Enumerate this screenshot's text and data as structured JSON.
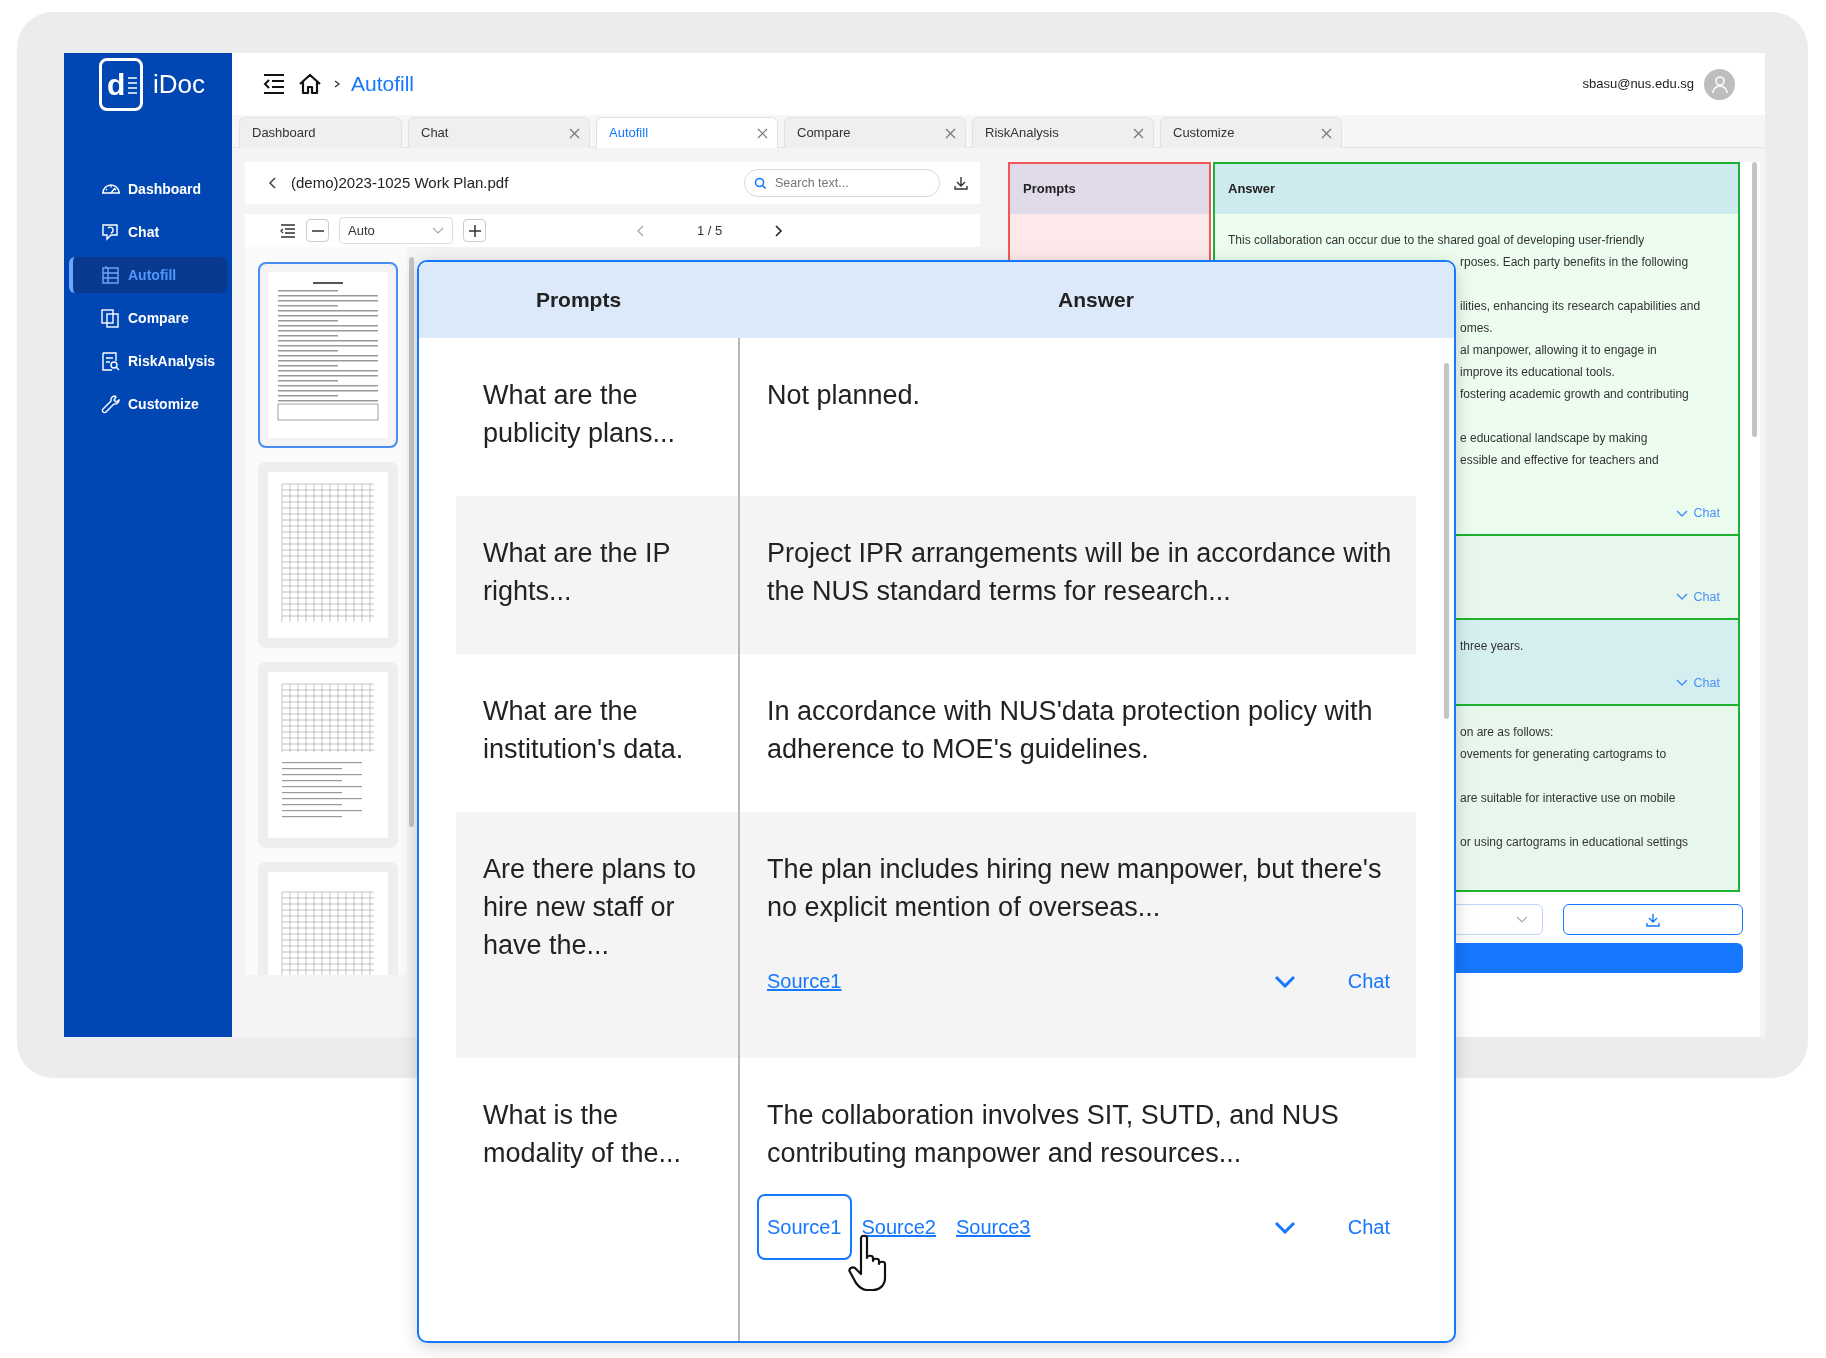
{
  "app": {
    "logo_mark": "d",
    "name": "iDoc"
  },
  "sidebar": {
    "items": [
      {
        "label": "Dashboard",
        "selected": false
      },
      {
        "label": "Chat",
        "selected": false
      },
      {
        "label": "Autofill",
        "selected": true
      },
      {
        "label": "Compare",
        "selected": false
      },
      {
        "label": "RiskAnalysis",
        "selected": false
      },
      {
        "label": "Customize",
        "selected": false
      }
    ]
  },
  "header": {
    "breadcrumb": "Autofill",
    "user_email": "sbasu@nus.edu.sg"
  },
  "tabs": [
    {
      "label": "Dashboard",
      "selected": false,
      "closable": false
    },
    {
      "label": "Chat",
      "selected": false,
      "closable": true
    },
    {
      "label": "Autofill",
      "selected": true,
      "closable": true
    },
    {
      "label": "Compare",
      "selected": false,
      "closable": true
    },
    {
      "label": "RiskAnalysis",
      "selected": false,
      "closable": true
    },
    {
      "label": "Customize",
      "selected": false,
      "closable": true
    }
  ],
  "pdf_viewer": {
    "file_name": "(demo)2023-1025 Work Plan.pdf",
    "search": {
      "placeholder": "Search text..."
    },
    "zoom": "Auto",
    "page_indicator": "1 / 5",
    "thumbnails": [
      {
        "selected": true
      },
      {
        "selected": false
      },
      {
        "selected": false
      },
      {
        "selected": false
      }
    ]
  },
  "results_panel": {
    "columns": [
      "Prompts",
      "Answer"
    ],
    "rows": [
      {
        "selected": false,
        "intro": "This collaboration can occur due to the shared goal of developing user-friendly",
        "paragraphs": [
          [
            "rposes. Each party benefits in the following"
          ],
          [
            "ilities, enhancing its research capabilities and",
            "omes.",
            "al manpower, allowing it to engage in",
            "improve its educational tools.",
            "fostering academic growth and contributing"
          ],
          [
            "e educational landscape by making",
            "essible and effective for teachers and"
          ]
        ],
        "chat": "Chat"
      },
      {
        "selected": false,
        "chat": "Chat"
      },
      {
        "selected": true,
        "paragraphs": [
          [
            "three years."
          ]
        ],
        "chat": "Chat"
      },
      {
        "selected": false,
        "paragraphs": [
          [
            "on are as follows:",
            "ovements for generating cartograms to"
          ],
          [
            "are suitable for interactive use on mobile"
          ],
          [
            "or using cartograms in educational settings"
          ]
        ]
      }
    ]
  },
  "popup": {
    "columns": [
      "Prompts",
      "Answer"
    ],
    "rows": [
      {
        "prompt": "What are the publicity plans...",
        "answer": "Not planned."
      },
      {
        "prompt": "What are the IP rights...",
        "answer": "Project IPR arrangements will be in accordance with the NUS standard terms for research..."
      },
      {
        "prompt": "What are the institution's data.",
        "answer": "In accordance with NUS'data protection policy with adherence to MOE's guidelines."
      },
      {
        "prompt": "Are there plans to hire new staff or have the...",
        "answer": "The plan includes hiring new manpower, but there's no explicit mention of overseas...",
        "sources": [
          {
            "label": "Source1",
            "selected": false
          }
        ],
        "chat": "Chat"
      },
      {
        "prompt": "What is the modality of the...",
        "answer": "The collaboration involves SIT, SUTD, and NUS contributing manpower and resources...",
        "sources": [
          {
            "label": "Source1",
            "selected": true
          },
          {
            "label": "Source2",
            "selected": false
          },
          {
            "label": "Source3",
            "selected": false
          }
        ],
        "chat": "Chat"
      }
    ]
  }
}
